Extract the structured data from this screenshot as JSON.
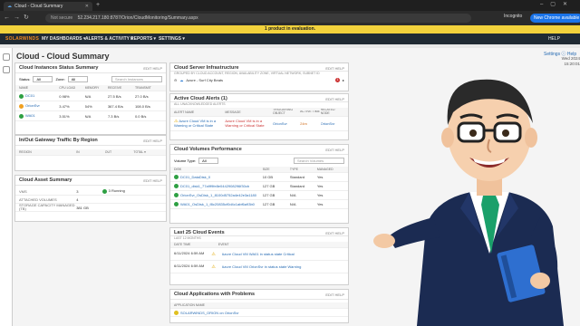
{
  "browser": {
    "tab_title": "Cloud - Cloud Summary",
    "url_prefix": "Not secure",
    "url": "52.234.217.180:8787/Orion/CloudMonitoring/Summary.aspx",
    "incognito": "Incognito",
    "new_chrome": "New Chrome available"
  },
  "eval_banner": "1 product in evaluation.",
  "nav": {
    "logo": "SOLARWINDS",
    "items": [
      "MY DASHBOARDS ▾",
      "ALERTS & ACTIVITY ▾",
      "REPORTS ▾",
      "SETTINGS ▾"
    ],
    "help": "HELP"
  },
  "page": {
    "title": "Cloud - Cloud Summary",
    "right_links": "Settings ⓘ Help",
    "date": "Wed 2024 15:20:01"
  },
  "panels": {
    "instances": {
      "title": "Cloud Instances Status Summary",
      "edit": "EDIT HELP",
      "status_label": "Status:",
      "status_value": "All",
      "zone_label": "Zone:",
      "zone_value": "All",
      "search_placeholder": "Search Instances",
      "headers": [
        "NAME",
        "CPU LOAD",
        "MEMORY",
        "RECEIVE",
        "TRANSMIT"
      ],
      "rows": [
        [
          "DC01",
          "0.98%",
          "N/A",
          "27.5 B/s",
          "27.0 B/s"
        ],
        [
          "OrionSvr",
          "3.47%",
          "54%",
          "367.4 B/s",
          "108.0 B/s"
        ],
        [
          "WA01",
          "3.51%",
          "N/A",
          "7.3 B/s",
          "0.0 B/s"
        ]
      ]
    },
    "gateway": {
      "title": "In/Out Gateway Traffic By Region",
      "edit": "EDIT HELP",
      "headers": [
        "REGION",
        "IN",
        "OUT",
        "TOTAL ▾"
      ]
    },
    "asset": {
      "title": "Cloud Asset Summary",
      "edit": "EDIT HELP",
      "rows": [
        [
          "VMS",
          "3",
          "3 Running"
        ],
        [
          "ATTACHED VOLUMES",
          "4",
          ""
        ],
        [
          "STORAGE CAPACITY MANAGED (TB)",
          "381 GB",
          ""
        ]
      ]
    },
    "infra": {
      "title": "Cloud Server Infrastructure",
      "sub": "GROUPED BY CLOUD ACCOUNT, REGION, AVAILABILITY ZONE, VIRTUAL NETWORK, SUBNET ID",
      "edit": "EDIT HELP",
      "item": "Azure - Surf City Beats",
      "count": "1"
    },
    "alerts": {
      "title": "Active Cloud Alerts (1)",
      "sub": "ALL UNACKNOWLEDGED ALERTS",
      "edit": "EDIT HELP",
      "headers": [
        "ALERT NAME",
        "MESSAGE",
        "TRIGGERING OBJECT",
        "ACTIVE TIME",
        "RELATED NODE"
      ],
      "rows": [
        [
          "Azure Cloud VM is in a Warning or Critical State",
          "Azure Cloud VM is in a Warning or Critical State",
          "OrionSvr",
          "24m",
          "OrionSvr"
        ]
      ]
    },
    "volumes": {
      "title": "Cloud Volumes Performance",
      "edit": "EDIT HELP",
      "type_label": "Volume Type:",
      "type_value": "All",
      "search_placeholder": "Search Volumes",
      "headers": [
        "DISK",
        "SIZE",
        "TYPE",
        "MANAGED"
      ],
      "rows": [
        [
          "DC01_DataDisk_0",
          "10 GB",
          "Standard",
          "Yes"
        ],
        [
          "DC01_disk1_77a9f9fe8e0442908296f30cb",
          "127 GB",
          "Standard",
          "Yes"
        ],
        [
          "OrionSvr_OsDisk_1_8100d5752a4e42e3a1180",
          "127 GB",
          "N/A",
          "Yes"
        ],
        [
          "WA01_OsDisk_1_f8c20835cf0d4c1abf6a93b0",
          "127 GB",
          "N/A",
          "Yes"
        ]
      ]
    },
    "events": {
      "title": "Last 25 Cloud Events",
      "sub": "LAST 12 MONTHS",
      "edit": "EDIT HELP",
      "headers": [
        "DATE TIME",
        "EVENT"
      ],
      "rows": [
        [
          "6/11/2024 6:59 AM",
          "Azure Cloud VM WA01 in status state Critical"
        ],
        [
          "6/11/2024 6:59 AM",
          "Azure Cloud VM OrionSvr in status state Warning"
        ]
      ]
    },
    "problems": {
      "title": "Cloud Applications with Problems",
      "edit": "EDIT HELP",
      "header": "APPLICATION NAME",
      "row": "SOLARWINDS_ORION on OrionSvr"
    }
  }
}
